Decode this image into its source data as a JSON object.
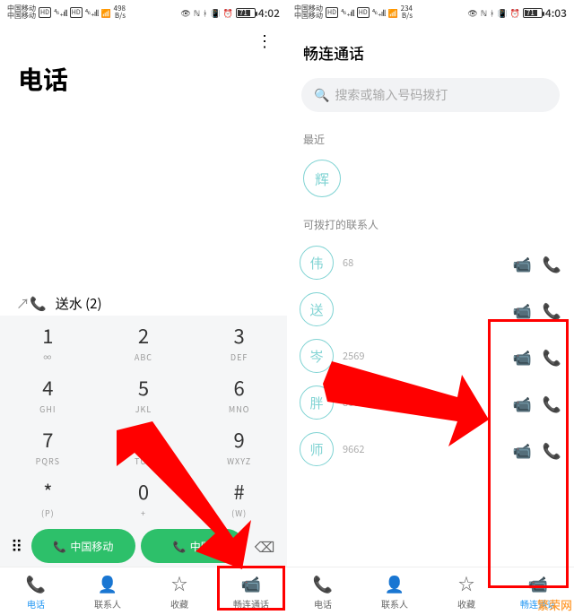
{
  "left": {
    "status": {
      "carrier": "中国移动",
      "rate_num": "498",
      "rate_unit": "B/s",
      "batt": "71",
      "time": "4:02"
    },
    "title": "电话",
    "recent_call": {
      "name": "送水",
      "count": "(2)"
    },
    "keys": [
      {
        "n": "1",
        "s": "∞"
      },
      {
        "n": "2",
        "s": "ABC"
      },
      {
        "n": "3",
        "s": "DEF"
      },
      {
        "n": "4",
        "s": "GHI"
      },
      {
        "n": "5",
        "s": "JKL"
      },
      {
        "n": "6",
        "s": "MNO"
      },
      {
        "n": "7",
        "s": "PQRS"
      },
      {
        "n": "8",
        "s": "TUV"
      },
      {
        "n": "9",
        "s": "WXYZ"
      },
      {
        "n": "*",
        "s": "(P)"
      },
      {
        "n": "0",
        "s": "+"
      },
      {
        "n": "#",
        "s": "(W)"
      }
    ],
    "sim1": "中国移动",
    "sim2": "中国",
    "tabs": [
      {
        "icon": "phone",
        "label": "电话"
      },
      {
        "icon": "contacts",
        "label": "联系人"
      },
      {
        "icon": "star",
        "label": "收藏"
      },
      {
        "icon": "video",
        "label": "畅连通话"
      }
    ]
  },
  "right": {
    "status": {
      "carrier": "中国移动",
      "rate_num": "234",
      "rate_unit": "B/s",
      "batt": "71",
      "time": "4:03"
    },
    "title": "畅连通话",
    "search_placeholder": "搜索或输入号码拨打",
    "recent_label": "最近",
    "recent_contact": "辉",
    "contacts_label": "可拨打的联系人",
    "contacts": [
      {
        "av": "伟",
        "num": "68"
      },
      {
        "av": "送",
        "num": ""
      },
      {
        "av": "岑",
        "num": "2569"
      },
      {
        "av": "胖",
        "num": "8609"
      },
      {
        "av": "师",
        "num": "9662"
      }
    ],
    "tabs": [
      {
        "icon": "phone",
        "label": "电话"
      },
      {
        "icon": "contacts",
        "label": "联系人"
      },
      {
        "icon": "star",
        "label": "收藏"
      },
      {
        "icon": "video",
        "label": "畅连通话"
      }
    ]
  },
  "watermark": "繁荣网"
}
